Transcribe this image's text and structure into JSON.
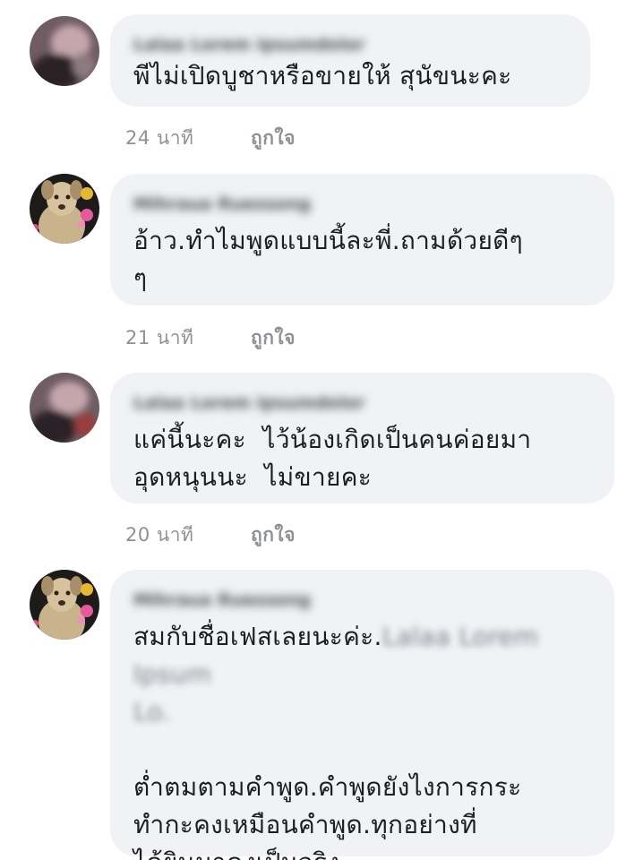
{
  "comments": [
    {
      "author": "Lalaa Lorem Ipsumdolor",
      "text": "พีไม่เปิดบูชาหรือขายให้ สุนัขนะคะ",
      "time": "24 นาที",
      "like": "ถูกใจ",
      "avatar_icon": "blurred-avatar-icon"
    },
    {
      "author": "Mihraua Ruessong",
      "text": "อ้าว.ทำไมพูดแบบนี้ละพี่.ถามด้วยดีๆ\nๆ",
      "time": "21 นาที",
      "like": "ถูกใจ",
      "avatar_icon": "dog-avatar-icon"
    },
    {
      "author": "Lalaa Lorem Ipsumdolor",
      "text": "แค่นี้นะคะ  ไว้น้องเกิดเป็นคนค่อยมา\nอุดหนุนนะ  ไม่ขายคะ",
      "time": "20 นาที",
      "like": "ถูกใจ",
      "avatar_icon": "blurred-avatar-icon"
    },
    {
      "author": "Mihraua Ruessong",
      "text_lead": "สมกับชื่อเฟสเลยนะค่ะ.",
      "text_blurred_1": "Lalaa Lorem Ipsum",
      "text_blurred_2": "Lo.",
      "text_rest": "ต่ำตมตามคำพูด.คำพูดยังไงการกระ\nทำกะคงเหมือนคำพูด.ทุกอย่างที่\nได้ยินมาคงเป็นจริง.",
      "avatar_icon": "dog-avatar-icon"
    }
  ]
}
